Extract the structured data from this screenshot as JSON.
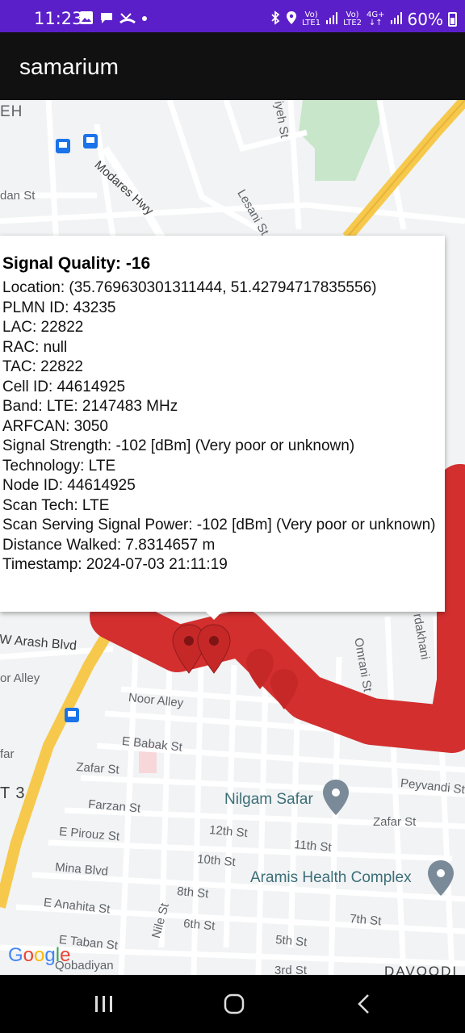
{
  "status_bar": {
    "time": "11:23",
    "battery": "60%",
    "net1": "LTE1",
    "net2": "LTE2",
    "net3": "4G+"
  },
  "app": {
    "title": "samarium"
  },
  "map": {
    "labels": {
      "modares": "Modares Hwy",
      "lesani": "Lesani St",
      "arash": "W Arash Blvd",
      "noor": "Noor Alley",
      "babak": "E Babak St",
      "zafar": "Zafar St",
      "zafar2": "Zafar St",
      "farzan": "Farzan St",
      "pirouz": "E Pirouz St",
      "mina": "Mina Blvd",
      "anahita": "E Anahita St",
      "taban": "E Taban St",
      "twelfth": "12th St",
      "eleventh": "11th St",
      "tenth": "10th St",
      "eighth": "8th St",
      "sixth": "6th St",
      "fifth": "5th St",
      "seventh": "7th St",
      "nile": "Nile St",
      "omrani": "Omrani St",
      "peyvandi": "Peyvandi St",
      "nilgam": "Nilgam Safar",
      "aramis": "Aramis Health Complex",
      "alley": "or Alley",
      "dan": "dan St",
      "eh": "EH",
      "t3": "T 3",
      "far": "far",
      "davoodi": "DAVOODI",
      "iyeh": "iyeh St",
      "rdakhani": "rdakhani",
      "qobadiyan": "Qobadiyan",
      "third": "3rd St"
    },
    "google_logo": "Google"
  },
  "info_window": {
    "title": "Signal Quality: -16",
    "lines": [
      "Location: (35.769630301311444, 51.42794717835556)",
      "PLMN ID: 43235",
      "LAC: 22822",
      "RAC: null",
      "TAC: 22822",
      "Cell ID: 44614925",
      "Band: LTE: 2147483 MHz",
      "ARFCAN: 3050",
      "Signal Strength: -102 [dBm] (Very poor or unknown)",
      "Technology: LTE",
      "Node ID: 44614925",
      "Scan Tech: LTE",
      "Scan Serving Signal Power: -102 [dBm] (Very poor or unknown)",
      "Distance Walked: 7.8314657 m",
      "Timestamp: 2024-07-03 21:11:19"
    ]
  },
  "colors": {
    "status_bar": "#5b1fc9",
    "app_bar": "#111111",
    "route": "#d32f2f",
    "highway": "#f6c94c",
    "park": "#c8e6c9"
  },
  "icons": [
    "image-icon",
    "chat-icon",
    "missed-call-icon",
    "dot-icon",
    "bluetooth-icon",
    "location-icon",
    "signal-icon",
    "battery-icon",
    "bus-stop-icon",
    "map-pin-icon",
    "recents-icon",
    "home-icon",
    "back-icon"
  ]
}
